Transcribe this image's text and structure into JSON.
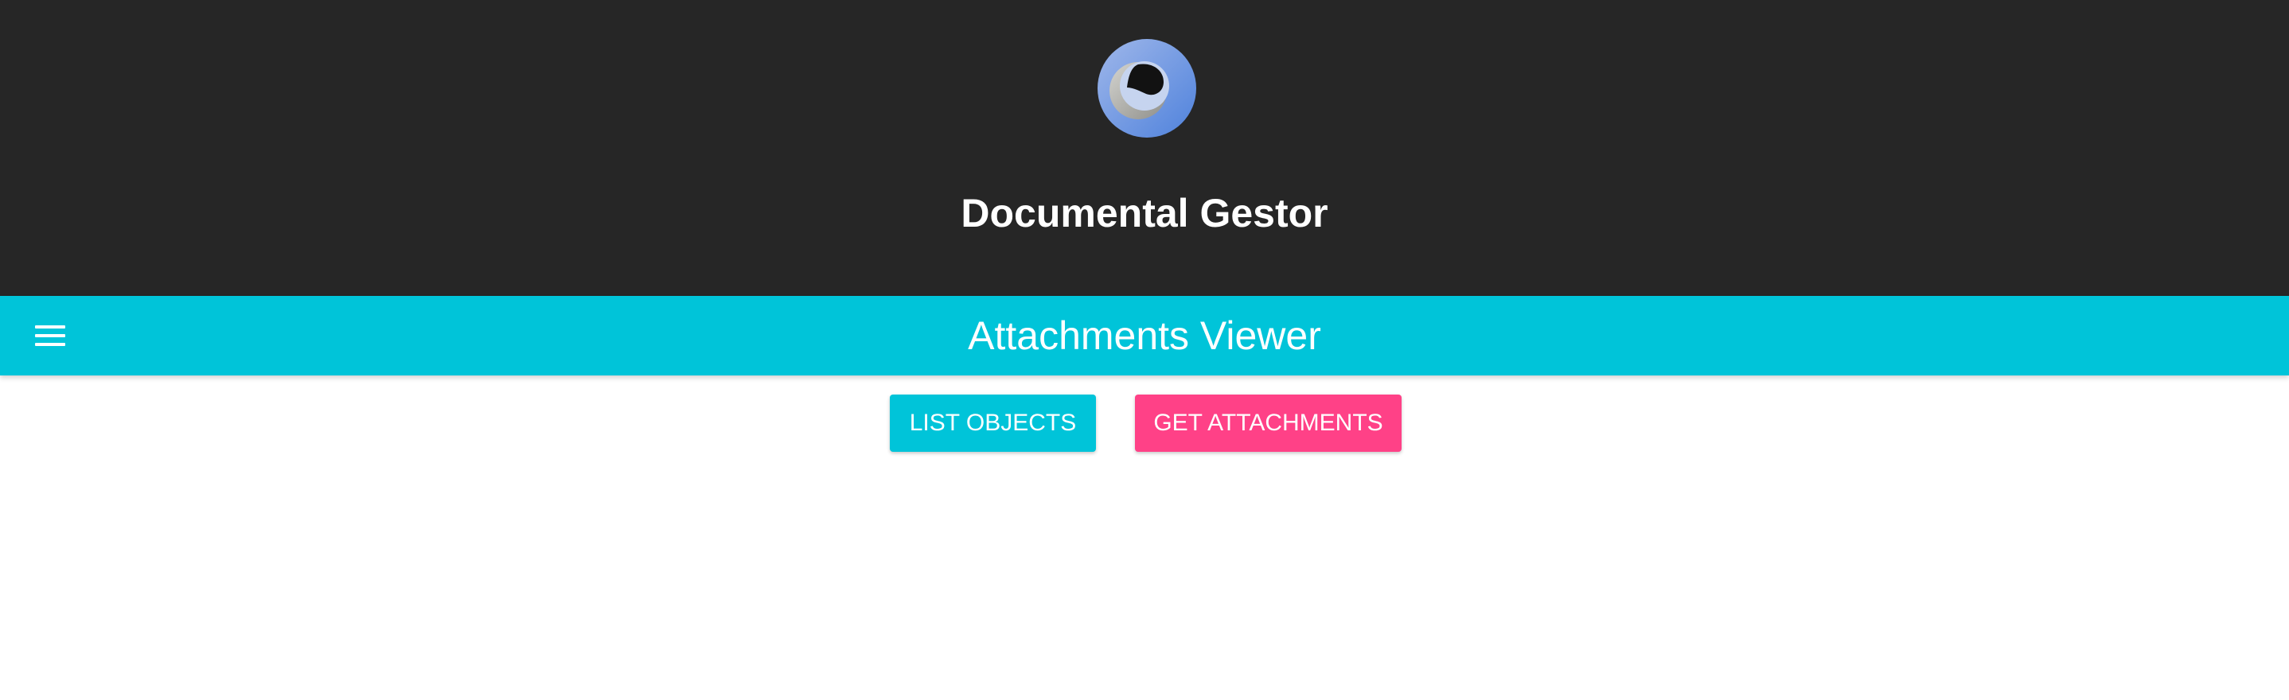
{
  "header": {
    "logo": "globe-logo",
    "title": "Documental Gestor"
  },
  "toolbar": {
    "menu_icon": "hamburger-menu-icon",
    "title": "Attachments Viewer"
  },
  "actions": {
    "list_objects_label": "LIST OBJECTS",
    "get_attachments_label": "GET ATTACHMENTS"
  },
  "colors": {
    "header_bg": "#262626",
    "toolbar_bg": "#00c4d9",
    "list_button_bg": "#00c4d9",
    "attachments_button_bg": "#ff4187"
  }
}
